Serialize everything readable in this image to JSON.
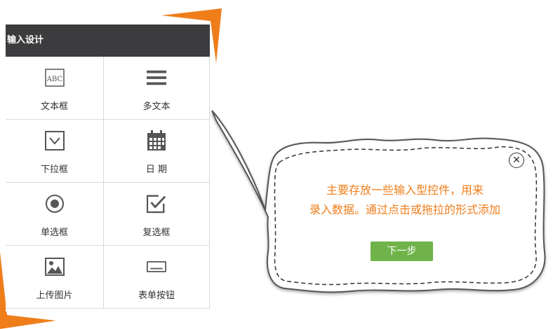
{
  "panel": {
    "title": "输入设计",
    "items": [
      {
        "label": "文本框",
        "icon": "text-box-icon"
      },
      {
        "label": "多文本",
        "icon": "multiline-text-icon"
      },
      {
        "label": "下拉框",
        "icon": "dropdown-icon"
      },
      {
        "label": "日 期",
        "icon": "calendar-icon"
      },
      {
        "label": "单选框",
        "icon": "radio-icon"
      },
      {
        "label": "复选框",
        "icon": "checkbox-icon"
      },
      {
        "label": "上传图片",
        "icon": "image-upload-icon"
      },
      {
        "label": "表单按钮",
        "icon": "form-button-icon"
      }
    ]
  },
  "tooltip": {
    "line1": "主要存放一些输入型控件，用来",
    "line2": "录入数据。通过点击或拖拉的形式添加",
    "next_label": "下一步",
    "close_icon": "close-icon"
  },
  "colors": {
    "accent": "#ef7d1a",
    "header_bg": "#3c3c3e",
    "button_green": "#6fb34a",
    "icon_gray": "#555555"
  }
}
